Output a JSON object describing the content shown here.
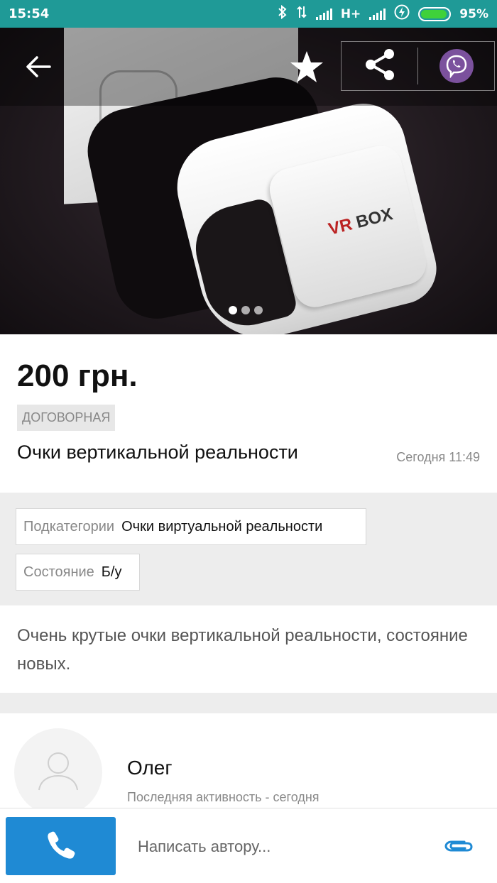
{
  "status_bar": {
    "time": "15:54",
    "network": "H+",
    "battery_percent": "95%",
    "battery_level": 0.95,
    "icons": [
      "bluetooth-icon",
      "data-transfer-icon",
      "signal-icon",
      "signal-icon",
      "charging-icon",
      "battery-icon"
    ]
  },
  "gallery": {
    "image_count": 3,
    "active_index": 0,
    "icons": [
      "back-arrow-icon",
      "star-icon",
      "share-icon",
      "viber-icon"
    ]
  },
  "listing": {
    "price": "200 грн.",
    "negotiable_label": "ДОГОВОРНАЯ",
    "title": "Очки вертикальной реальности",
    "posted": "Сегодня 11:49"
  },
  "attributes": [
    {
      "key": "Подкатегории",
      "value": "Очки виртуальной реальности"
    },
    {
      "key": "Состояние",
      "value": "Б/у"
    }
  ],
  "description": "Очень крутые очки вертикальной реальности, состояние новых.",
  "author": {
    "name": "Олег",
    "last_active": "Последняя активность - сегодня"
  },
  "bottom_bar": {
    "message_placeholder": "Написать автору...",
    "icons": [
      "phone-icon",
      "paperclip-icon"
    ]
  },
  "colors": {
    "status_bar": "#1f9a97",
    "call_button": "#1f8ad4",
    "viber": "#7b519d",
    "battery": "#3fd13a"
  }
}
